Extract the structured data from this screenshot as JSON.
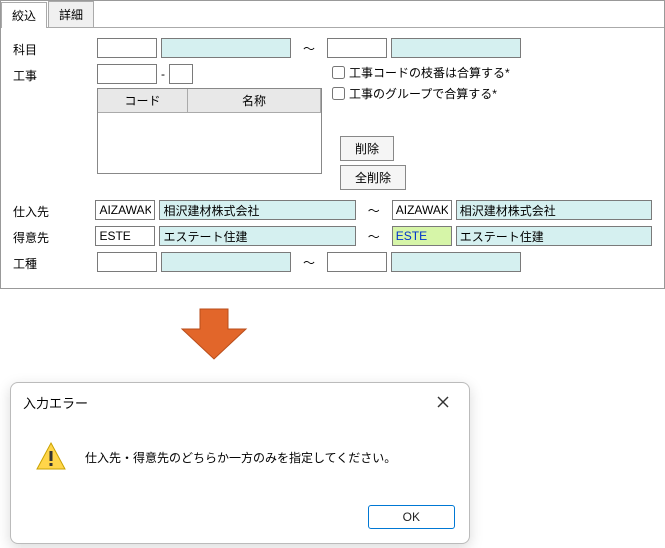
{
  "tabs": {
    "filter": "絞込",
    "detail": "詳細"
  },
  "labels": {
    "kamoku": "科目",
    "kouji": "工事",
    "shiiresaki": "仕入先",
    "tokuisaki": "得意先",
    "koushu": "工種"
  },
  "grid": {
    "code": "コード",
    "name": "名称"
  },
  "checks": {
    "codebranch": "工事コードの枝番は合算する*",
    "group": "工事のグループで合算する*"
  },
  "buttons": {
    "delete": "削除",
    "deleteall": "全削除",
    "ok": "OK"
  },
  "shiiresaki": {
    "from_code": "AIZAWAKE",
    "from_name": "相沢建材株式会社",
    "to_code": "AIZAWAKE",
    "to_name": "相沢建材株式会社"
  },
  "tokuisaki": {
    "from_code": "ESTE",
    "from_name": "エステート住建",
    "to_code": "ESTE",
    "to_name": "エステート住建"
  },
  "tilde": "～",
  "dialog": {
    "title": "入力エラー",
    "message": "仕入先・得意先のどちらか一方のみを指定してください。"
  }
}
